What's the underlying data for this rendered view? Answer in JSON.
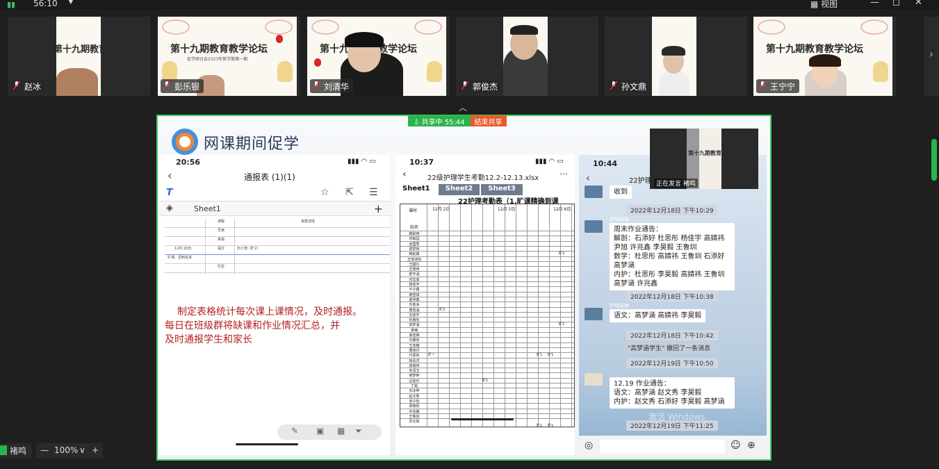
{
  "topbar": {
    "timer": "56:10",
    "view_label": "视图",
    "signal_icon": "signal-icon",
    "minimize": "—",
    "maximize": "◻",
    "close": "✕"
  },
  "participants": [
    {
      "name": "赵冰"
    },
    {
      "name": "彭乐银"
    },
    {
      "name": "刘清华"
    },
    {
      "name": "郭俊杰"
    },
    {
      "name": "孙文鼎"
    },
    {
      "name": "王宁宁"
    }
  ],
  "poster": {
    "title": "第十九期教育教学论坛",
    "subtitle": "促学研讨会2023年新学期第一期"
  },
  "share_bar": {
    "status": "共享中 55:44",
    "end_label": "结束共享"
  },
  "slide": {
    "brand": "网课期间促学",
    "panel1": {
      "time": "20:56",
      "title": "通报表 (1)(1)",
      "sheet_tab": "Sheet1",
      "notes_line1": "制定表格统计每次课上课情况，及时通报。",
      "notes_line2": "每日在班级群将缺课和作业情况汇总，并",
      "notes_line3": "及时通报学生和家长",
      "grid_labels": [
        "课程",
        "考勤详情",
        "早读",
        "英语",
        "12月 20日",
        "扩课、迟到名单",
        "语文",
        "石少涛（旷2）",
        "历史"
      ]
    },
    "panel2": {
      "time": "10:37",
      "title": "22级护理学生考勤12.2-12.13.xlsx",
      "tabs": [
        "Sheet1",
        "Sheet2",
        "Sheet3"
      ],
      "sheet_title": "22护理考勤表（1.旷课精确到课",
      "date_headers": [
        "12月 2日",
        "12月 5日",
        "12月 6日"
      ],
      "header_cells": [
        "课时",
        "姓名"
      ],
      "names": [
        "韩默冉",
        "苏毅园",
        "池国秀",
        "郭梦林",
        "韩延鑫",
        "王佳诗怡",
        "王越凡",
        "王楼冉",
        "欧宇涵",
        "邓志成",
        "杨佳宇",
        "平子鑫",
        "韩雪琪",
        "夏林鑫",
        "刘金洲",
        "曹若涵",
        "刘佳齐",
        "杭雨欣",
        "高梦涵",
        "吴楠",
        "高佳琳",
        "刘鑫佳",
        "王亚楠",
        "曹晓月",
        "付思彤",
        "田青洋",
        "高婧玮",
        "宋清文",
        "吴梦婷",
        "边佳乐",
        "丁铭",
        "刘冰梓",
        "赵文秀",
        "张子怡",
        "梁德彤",
        "许兆鑫",
        "王鲁圳",
        "孙文倩"
      ],
      "marks": [
        "旷2",
        "旷2",
        "旷2",
        "旷一",
        "旷1",
        "旷1",
        "旷1",
        "旷1",
        "旷1"
      ]
    },
    "panel3": {
      "time": "10:44",
      "title": "22护理",
      "msg_received": "收到",
      "sender": "护理吴楠",
      "ts1": "2022年12月18日 下午10:29",
      "homework_title": "周末作业通告：",
      "homework_body": "解剖：石添好 杜思彤 杨佳宇 高婧祎 尹旭 许兆鑫 李昊毅 王鲁圳",
      "homework_body2": "数学：杜思彤 高婧祎 王鲁圳 石添好 高梦涵",
      "homework_body3": "内护：杜思彤 李昊毅 高婧祎 王鲁圳 高梦涵 许兆鑫",
      "ts2": "2022年12月18日 下午10:38",
      "msg_chinese": "语文：高梦涵 高婧祎 李昊毅",
      "ts3": "2022年12月18日 下午10:42",
      "recall": "\"高梦涵学生\" 撤回了一条消息",
      "ts4": "2022年12月19日 下午10:50",
      "hw2_title": "12.19 作业通告：",
      "hw2_l1": "语文：高梦涵 赵文秀 李昊毅",
      "hw2_l2": "内护：赵文秀 石添好 李昊毅 高梦涵",
      "ts5": "2022年12月19日 下午11:25",
      "watermark": "激活 Windows"
    }
  },
  "speaker": {
    "label": "正在发言 褚鸣"
  },
  "bottombar": {
    "user": "褚鸣",
    "zoom": "100%",
    "zoom_caret": "∨",
    "minus": "—",
    "plus": "+"
  }
}
